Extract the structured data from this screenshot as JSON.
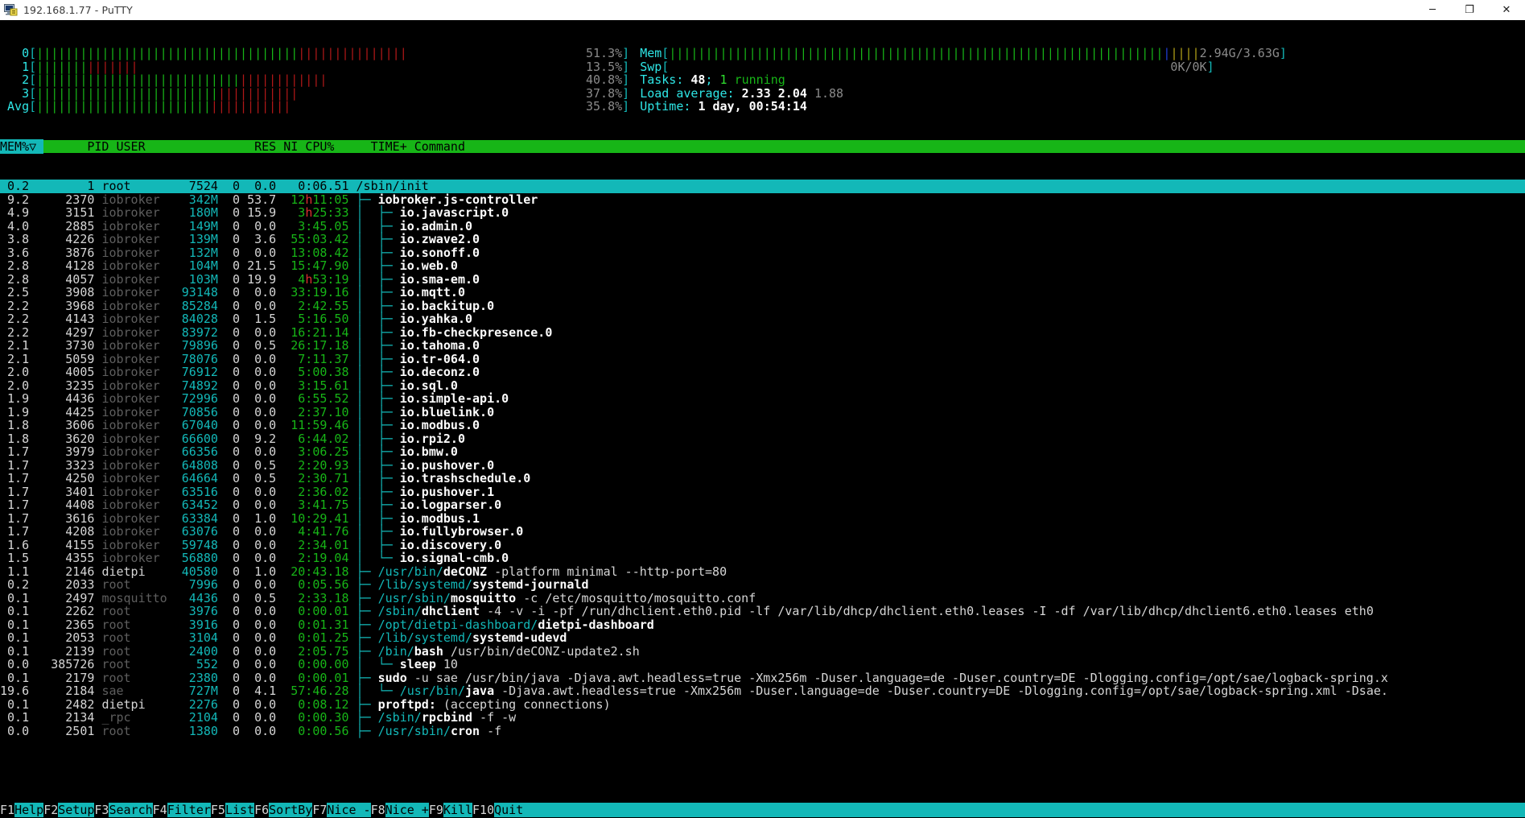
{
  "window": {
    "title": "192.168.1.77 - PuTTY",
    "icon": "putty-terminal-icon",
    "minimize_label": "─",
    "maximize_label": "❐",
    "close_label": "✕"
  },
  "cpu_meters": [
    {
      "label": "0",
      "pct": "51.3%",
      "normal": 51.3,
      "system": 22.0,
      "bar_green": 36,
      "bar_red": 15
    },
    {
      "label": "1",
      "pct": "13.5%",
      "normal": 6.0,
      "system": 7.5,
      "bar_green": 7,
      "bar_red": 7
    },
    {
      "label": "2",
      "pct": "40.8%",
      "normal": 28.0,
      "system": 12.8,
      "bar_green": 28,
      "bar_red": 12
    },
    {
      "label": "3",
      "pct": "37.8%",
      "normal": 26.0,
      "system": 11.8,
      "bar_green": 25,
      "bar_red": 11
    },
    {
      "label": "Avg",
      "pct": "35.8%",
      "normal": 24.0,
      "system": 11.8,
      "bar_green": 24,
      "bar_red": 11
    }
  ],
  "right_meters": {
    "mem": {
      "label": "Mem",
      "value": "2.94G/3.63G",
      "used_pct": 81,
      "bar_green": 44,
      "bar_blue": 1,
      "bar_yellow": 4
    },
    "swp": {
      "label": "Swp",
      "value": "0K/0K",
      "used_pct": 0
    },
    "tasks": {
      "label": "Tasks:",
      "count": "48",
      "sep": ";",
      "running": "1",
      "running_label": "running"
    },
    "load": {
      "label": "Load average:",
      "v1": "2.33",
      "v2": "2.04",
      "v3": "1.88"
    },
    "uptime": {
      "label": "Uptime:",
      "value": "1 day, 00:54:14"
    }
  },
  "columns": {
    "sorted": "MEM%▽",
    "headers": [
      "PID",
      "USER",
      "RES",
      "NI",
      "CPU%",
      "TIME+",
      "Command"
    ]
  },
  "processes": [
    {
      "mem": "0.2",
      "pid": "1",
      "user": "root",
      "res": "7524",
      "ni": "0",
      "cpu": "0.0",
      "time": "0:06.51",
      "tree": "",
      "cmd_dir": "/sbin/",
      "cmd_base": "init",
      "cmd_args": "",
      "selected": true,
      "res_unit": ""
    },
    {
      "mem": "9.2",
      "pid": "2370",
      "user": "iobroker",
      "res": "342M",
      "ni": "0",
      "cpu": "53.7",
      "time": "12h11:05",
      "time_hot": true,
      "tree": "├─ ",
      "cmd_dir": "",
      "cmd_base": "iobroker.js-controller",
      "cmd_args": ""
    },
    {
      "mem": "4.9",
      "pid": "3151",
      "user": "iobroker",
      "res": "180M",
      "ni": "0",
      "cpu": "15.9",
      "time": "3h25:33",
      "time_hot": true,
      "tree": "│  ├─ ",
      "cmd_dir": "",
      "cmd_base": "io.javascript.0",
      "cmd_args": ""
    },
    {
      "mem": "4.0",
      "pid": "2885",
      "user": "iobroker",
      "res": "149M",
      "ni": "0",
      "cpu": "0.0",
      "time": "3:45.05",
      "tree": "│  ├─ ",
      "cmd_dir": "",
      "cmd_base": "io.admin.0",
      "cmd_args": ""
    },
    {
      "mem": "3.8",
      "pid": "4226",
      "user": "iobroker",
      "res": "139M",
      "ni": "0",
      "cpu": "3.6",
      "time": "55:03.42",
      "tree": "│  ├─ ",
      "cmd_dir": "",
      "cmd_base": "io.zwave2.0",
      "cmd_args": ""
    },
    {
      "mem": "3.6",
      "pid": "3876",
      "user": "iobroker",
      "res": "132M",
      "ni": "0",
      "cpu": "0.0",
      "time": "13:08.42",
      "tree": "│  ├─ ",
      "cmd_dir": "",
      "cmd_base": "io.sonoff.0",
      "cmd_args": ""
    },
    {
      "mem": "2.8",
      "pid": "4128",
      "user": "iobroker",
      "res": "104M",
      "ni": "0",
      "cpu": "21.5",
      "time": "15:47.90",
      "tree": "│  ├─ ",
      "cmd_dir": "",
      "cmd_base": "io.web.0",
      "cmd_args": ""
    },
    {
      "mem": "2.8",
      "pid": "4057",
      "user": "iobroker",
      "res": "103M",
      "ni": "0",
      "cpu": "19.9",
      "time": "4h53:19",
      "time_hot": true,
      "tree": "│  ├─ ",
      "cmd_dir": "",
      "cmd_base": "io.sma-em.0",
      "cmd_args": ""
    },
    {
      "mem": "2.5",
      "pid": "3908",
      "user": "iobroker",
      "res": "93148",
      "ni": "0",
      "cpu": "0.0",
      "time": "33:19.16",
      "tree": "│  ├─ ",
      "cmd_dir": "",
      "cmd_base": "io.mqtt.0",
      "cmd_args": ""
    },
    {
      "mem": "2.2",
      "pid": "3968",
      "user": "iobroker",
      "res": "85284",
      "ni": "0",
      "cpu": "0.0",
      "time": "2:42.55",
      "tree": "│  ├─ ",
      "cmd_dir": "",
      "cmd_base": "io.backitup.0",
      "cmd_args": ""
    },
    {
      "mem": "2.2",
      "pid": "4143",
      "user": "iobroker",
      "res": "84028",
      "ni": "0",
      "cpu": "1.5",
      "time": "5:16.50",
      "tree": "│  ├─ ",
      "cmd_dir": "",
      "cmd_base": "io.yahka.0",
      "cmd_args": ""
    },
    {
      "mem": "2.2",
      "pid": "4297",
      "user": "iobroker",
      "res": "83972",
      "ni": "0",
      "cpu": "0.0",
      "time": "16:21.14",
      "tree": "│  ├─ ",
      "cmd_dir": "",
      "cmd_base": "io.fb-checkpresence.0",
      "cmd_args": ""
    },
    {
      "mem": "2.1",
      "pid": "3730",
      "user": "iobroker",
      "res": "79896",
      "ni": "0",
      "cpu": "0.5",
      "time": "26:17.18",
      "tree": "│  ├─ ",
      "cmd_dir": "",
      "cmd_base": "io.tahoma.0",
      "cmd_args": ""
    },
    {
      "mem": "2.1",
      "pid": "5059",
      "user": "iobroker",
      "res": "78076",
      "ni": "0",
      "cpu": "0.0",
      "time": "7:11.37",
      "tree": "│  ├─ ",
      "cmd_dir": "",
      "cmd_base": "io.tr-064.0",
      "cmd_args": ""
    },
    {
      "mem": "2.0",
      "pid": "4005",
      "user": "iobroker",
      "res": "76912",
      "ni": "0",
      "cpu": "0.0",
      "time": "5:00.38",
      "tree": "│  ├─ ",
      "cmd_dir": "",
      "cmd_base": "io.deconz.0",
      "cmd_args": ""
    },
    {
      "mem": "2.0",
      "pid": "3235",
      "user": "iobroker",
      "res": "74892",
      "ni": "0",
      "cpu": "0.0",
      "time": "3:15.61",
      "tree": "│  ├─ ",
      "cmd_dir": "",
      "cmd_base": "io.sql.0",
      "cmd_args": ""
    },
    {
      "mem": "1.9",
      "pid": "4436",
      "user": "iobroker",
      "res": "72996",
      "ni": "0",
      "cpu": "0.0",
      "time": "6:55.52",
      "tree": "│  ├─ ",
      "cmd_dir": "",
      "cmd_base": "io.simple-api.0",
      "cmd_args": ""
    },
    {
      "mem": "1.9",
      "pid": "4425",
      "user": "iobroker",
      "res": "70856",
      "ni": "0",
      "cpu": "0.0",
      "time": "2:37.10",
      "tree": "│  ├─ ",
      "cmd_dir": "",
      "cmd_base": "io.bluelink.0",
      "cmd_args": ""
    },
    {
      "mem": "1.8",
      "pid": "3606",
      "user": "iobroker",
      "res": "67040",
      "ni": "0",
      "cpu": "0.0",
      "time": "11:59.46",
      "tree": "│  ├─ ",
      "cmd_dir": "",
      "cmd_base": "io.modbus.0",
      "cmd_args": ""
    },
    {
      "mem": "1.8",
      "pid": "3620",
      "user": "iobroker",
      "res": "66600",
      "ni": "0",
      "cpu": "9.2",
      "time": "6:44.02",
      "tree": "│  ├─ ",
      "cmd_dir": "",
      "cmd_base": "io.rpi2.0",
      "cmd_args": ""
    },
    {
      "mem": "1.7",
      "pid": "3979",
      "user": "iobroker",
      "res": "66356",
      "ni": "0",
      "cpu": "0.0",
      "time": "3:06.25",
      "tree": "│  ├─ ",
      "cmd_dir": "",
      "cmd_base": "io.bmw.0",
      "cmd_args": ""
    },
    {
      "mem": "1.7",
      "pid": "3323",
      "user": "iobroker",
      "res": "64808",
      "ni": "0",
      "cpu": "0.5",
      "time": "2:20.93",
      "tree": "│  ├─ ",
      "cmd_dir": "",
      "cmd_base": "io.pushover.0",
      "cmd_args": ""
    },
    {
      "mem": "1.7",
      "pid": "4250",
      "user": "iobroker",
      "res": "64664",
      "ni": "0",
      "cpu": "0.5",
      "time": "2:30.71",
      "tree": "│  ├─ ",
      "cmd_dir": "",
      "cmd_base": "io.trashschedule.0",
      "cmd_args": ""
    },
    {
      "mem": "1.7",
      "pid": "3401",
      "user": "iobroker",
      "res": "63516",
      "ni": "0",
      "cpu": "0.0",
      "time": "2:36.02",
      "tree": "│  ├─ ",
      "cmd_dir": "",
      "cmd_base": "io.pushover.1",
      "cmd_args": ""
    },
    {
      "mem": "1.7",
      "pid": "4408",
      "user": "iobroker",
      "res": "63452",
      "ni": "0",
      "cpu": "0.0",
      "time": "3:41.75",
      "tree": "│  ├─ ",
      "cmd_dir": "",
      "cmd_base": "io.logparser.0",
      "cmd_args": ""
    },
    {
      "mem": "1.7",
      "pid": "3616",
      "user": "iobroker",
      "res": "63384",
      "ni": "0",
      "cpu": "1.0",
      "time": "10:29.41",
      "tree": "│  ├─ ",
      "cmd_dir": "",
      "cmd_base": "io.modbus.1",
      "cmd_args": ""
    },
    {
      "mem": "1.7",
      "pid": "4208",
      "user": "iobroker",
      "res": "63076",
      "ni": "0",
      "cpu": "0.0",
      "time": "4:41.76",
      "tree": "│  ├─ ",
      "cmd_dir": "",
      "cmd_base": "io.fullybrowser.0",
      "cmd_args": ""
    },
    {
      "mem": "1.6",
      "pid": "4155",
      "user": "iobroker",
      "res": "59748",
      "ni": "0",
      "cpu": "0.0",
      "time": "2:34.01",
      "tree": "│  ├─ ",
      "cmd_dir": "",
      "cmd_base": "io.discovery.0",
      "cmd_args": ""
    },
    {
      "mem": "1.5",
      "pid": "4355",
      "user": "iobroker",
      "res": "56880",
      "ni": "0",
      "cpu": "0.0",
      "time": "2:19.04",
      "tree": "│  └─ ",
      "cmd_dir": "",
      "cmd_base": "io.signal-cmb.0",
      "cmd_args": ""
    },
    {
      "mem": "1.1",
      "pid": "2146",
      "user": "dietpi",
      "user_bright": true,
      "res": "40580",
      "ni": "0",
      "cpu": "1.0",
      "time": "20:43.18",
      "tree": "├─ ",
      "cmd_dir": "/usr/bin/",
      "cmd_base": "deCONZ",
      "cmd_args": " -platform minimal --http-port=80"
    },
    {
      "mem": "0.2",
      "pid": "2033",
      "user": "root",
      "res": "7996",
      "ni": "0",
      "cpu": "0.0",
      "time": "0:05.56",
      "tree": "├─ ",
      "cmd_dir": "/lib/systemd/",
      "cmd_base": "systemd-journald",
      "cmd_args": ""
    },
    {
      "mem": "0.1",
      "pid": "2497",
      "user": "mosquitto",
      "res": "4436",
      "ni": "0",
      "cpu": "0.5",
      "time": "2:33.18",
      "tree": "├─ ",
      "cmd_dir": "/usr/sbin/",
      "cmd_base": "mosquitto",
      "cmd_args": " -c /etc/mosquitto/mosquitto.conf"
    },
    {
      "mem": "0.1",
      "pid": "2262",
      "user": "root",
      "res": "3976",
      "ni": "0",
      "cpu": "0.0",
      "time": "0:00.01",
      "tree": "├─ ",
      "cmd_dir": "/sbin/",
      "cmd_base": "dhclient",
      "cmd_args": " -4 -v -i -pf /run/dhclient.eth0.pid -lf /var/lib/dhcp/dhclient.eth0.leases -I -df /var/lib/dhcp/dhclient6.eth0.leases eth0"
    },
    {
      "mem": "0.1",
      "pid": "2365",
      "user": "root",
      "res": "3916",
      "ni": "0",
      "cpu": "0.0",
      "time": "0:01.31",
      "tree": "├─ ",
      "cmd_dir": "/opt/dietpi-dashboard/",
      "cmd_base": "dietpi-dashboard",
      "cmd_args": ""
    },
    {
      "mem": "0.1",
      "pid": "2053",
      "user": "root",
      "res": "3104",
      "ni": "0",
      "cpu": "0.0",
      "time": "0:01.25",
      "tree": "├─ ",
      "cmd_dir": "/lib/systemd/",
      "cmd_base": "systemd-udevd",
      "cmd_args": ""
    },
    {
      "mem": "0.1",
      "pid": "2139",
      "user": "root",
      "res": "2400",
      "ni": "0",
      "cpu": "0.0",
      "time": "2:05.75",
      "tree": "├─ ",
      "cmd_dir": "/bin/",
      "cmd_base": "bash",
      "cmd_args": " /usr/bin/deCONZ-update2.sh"
    },
    {
      "mem": "0.0",
      "pid": "385726",
      "user": "root",
      "res": "552",
      "ni": "0",
      "cpu": "0.0",
      "time": "0:00.00",
      "tree": "│  └─ ",
      "cmd_dir": "",
      "cmd_base": "sleep",
      "cmd_args": " 10"
    },
    {
      "mem": "0.1",
      "pid": "2179",
      "user": "root",
      "res": "2380",
      "ni": "0",
      "cpu": "0.0",
      "time": "0:00.01",
      "tree": "├─ ",
      "cmd_dir": "",
      "cmd_base": "sudo",
      "cmd_args": " -u sae /usr/bin/java -Djava.awt.headless=true -Xmx256m -Duser.language=de -Duser.country=DE -Dlogging.config=/opt/sae/logback-spring.x"
    },
    {
      "mem": "19.6",
      "pid": "2184",
      "user": "sae",
      "res": "727M",
      "ni": "0",
      "cpu": "4.1",
      "time": "57:46.28",
      "tree": "│  └─ ",
      "cmd_dir": "/usr/bin/",
      "cmd_base": "java",
      "cmd_args": " -Djava.awt.headless=true -Xmx256m -Duser.language=de -Duser.country=DE -Dlogging.config=/opt/sae/logback-spring.xml -Dsae."
    },
    {
      "mem": "0.1",
      "pid": "2482",
      "user": "dietpi",
      "user_bright": true,
      "res": "2276",
      "ni": "0",
      "cpu": "0.0",
      "time": "0:08.12",
      "tree": "├─ ",
      "cmd_dir": "",
      "cmd_base": "proftpd:",
      "cmd_args": " (accepting connections)"
    },
    {
      "mem": "0.1",
      "pid": "2134",
      "user": "_rpc",
      "res": "2104",
      "ni": "0",
      "cpu": "0.0",
      "time": "0:00.30",
      "tree": "├─ ",
      "cmd_dir": "/sbin/",
      "cmd_base": "rpcbind",
      "cmd_args": " -f -w"
    },
    {
      "mem": "0.0",
      "pid": "2501",
      "user": "root",
      "res": "1380",
      "ni": "0",
      "cpu": "0.0",
      "time": "0:00.56",
      "tree": "├─ ",
      "cmd_dir": "/usr/sbin/",
      "cmd_base": "cron",
      "cmd_args": " -f"
    }
  ],
  "function_keys": [
    {
      "key": "F1",
      "label": "Help"
    },
    {
      "key": "F2",
      "label": "Setup"
    },
    {
      "key": "F3",
      "label": "Search"
    },
    {
      "key": "F4",
      "label": "Filter"
    },
    {
      "key": "F5",
      "label": "List"
    },
    {
      "key": "F6",
      "label": "SortBy"
    },
    {
      "key": "F7",
      "label": "Nice -"
    },
    {
      "key": "F8",
      "label": "Nice +"
    },
    {
      "key": "F9",
      "label": "Kill"
    },
    {
      "key": "F10",
      "label": "Quit"
    }
  ],
  "colors": {
    "accent_cyan": "#13b8b8",
    "header_green": "#17b517",
    "bar_green": "#17b517",
    "bar_red": "#b01818",
    "bar_blue": "#1f3fd8",
    "bar_yellow": "#b0a017",
    "terminal_bg": "#000000",
    "titlebar_bg": "#ffffff"
  }
}
